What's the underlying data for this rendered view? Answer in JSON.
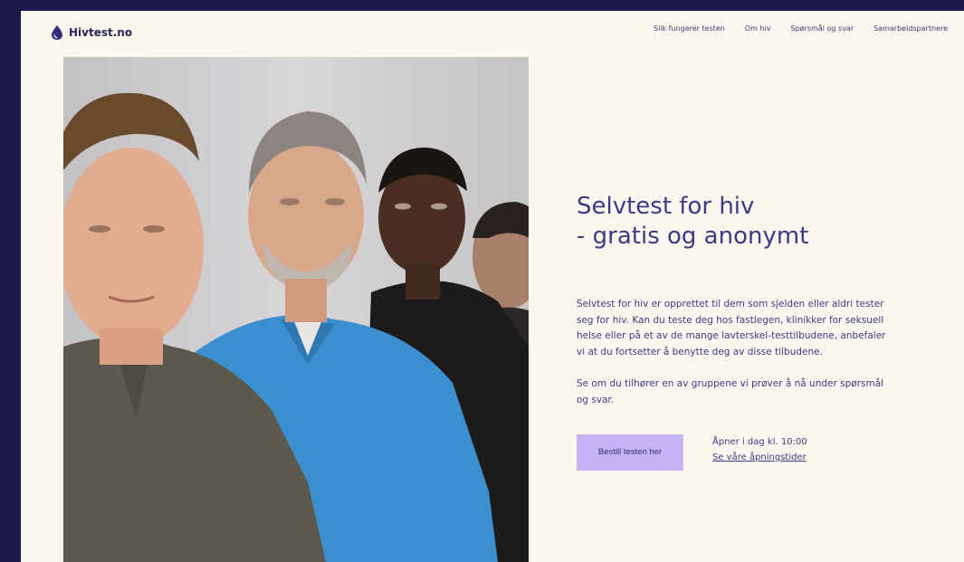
{
  "header": {
    "logo_text": "Hivtest.no",
    "logo_icon": "drop-icon",
    "nav": [
      {
        "label": "Slik fungerer testen"
      },
      {
        "label": "Om hiv"
      },
      {
        "label": "Spørsmål og svar"
      },
      {
        "label": "Samarbeidspartnere"
      }
    ]
  },
  "hero": {
    "title_line1": "Selvtest for hiv",
    "title_line2": "- gratis og anonymt",
    "paragraph1": "Selvtest for hiv er opprettet til dem som sjelden eller aldri tester seg for hiv. Kan du teste deg hos fastlegen, klinikker for seksuell helse eller på et av de mange lavterskel-testtilbudene, anbefaler vi at du fortsetter å benytte deg av disse tilbudene.",
    "paragraph2": "Se om du tilhører en av gruppene vi prøver å nå under spørsmål og svar.",
    "cta_label": "Bestill testen her",
    "opening_text": "Åpner i dag kl. 10:00",
    "opening_link": "Se våre åpningstider"
  },
  "colors": {
    "background_frame": "#1b1a4a",
    "page_background": "#fbf7ee",
    "text_primary": "#3c3a86",
    "cta_background": "#c9b3f7"
  }
}
